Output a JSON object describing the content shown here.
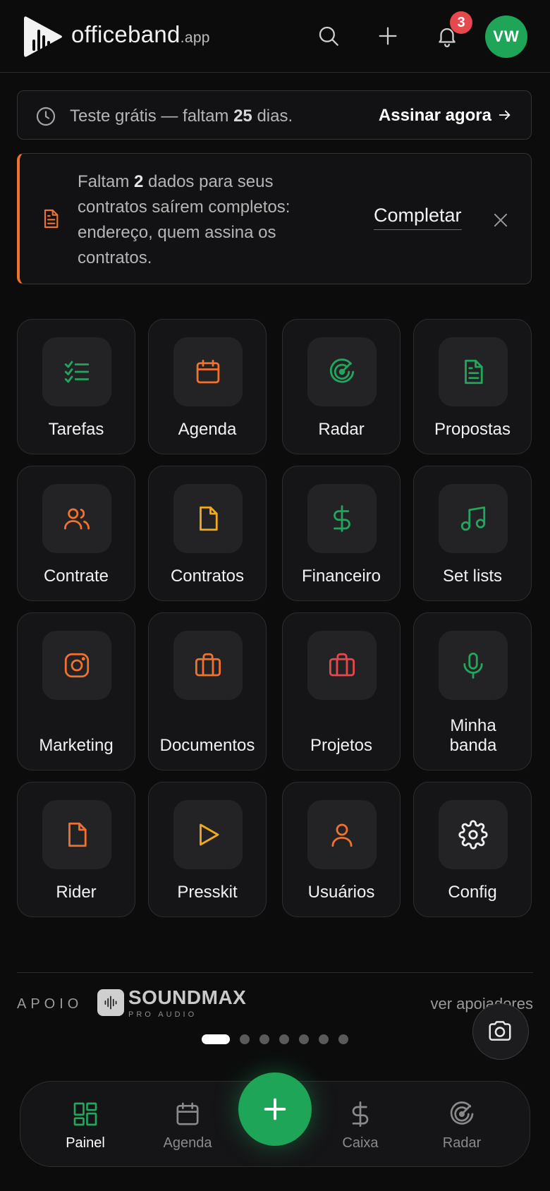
{
  "header": {
    "brand_name": "officeband",
    "brand_suffix": ".app",
    "notifications_count": "3",
    "avatar_initials": "VW"
  },
  "trial": {
    "text_before": "Teste grátis — faltam ",
    "days": "25",
    "text_after": " dias.",
    "cta": "Assinar agora"
  },
  "warning": {
    "text_before": "Faltam ",
    "count": "2",
    "text_after": " dados para seus contratos saírem completos: endereço, quem assina os contratos.",
    "action": "Completar"
  },
  "tiles": [
    {
      "label": "Tarefas",
      "icon": "checklist-icon",
      "color": "#22a55c"
    },
    {
      "label": "Agenda",
      "icon": "calendar-icon",
      "color": "#f07230"
    },
    {
      "label": "Radar",
      "icon": "radar-icon",
      "color": "#22a55c"
    },
    {
      "label": "Propostas",
      "icon": "file-text-icon",
      "color": "#22a55c"
    },
    {
      "label": "Contrate",
      "icon": "users-icon",
      "color": "#f07230"
    },
    {
      "label": "Contratos",
      "icon": "file-icon",
      "color": "#f2aa1a"
    },
    {
      "label": "Financeiro",
      "icon": "dollar-icon",
      "color": "#22a55c"
    },
    {
      "label": "Set lists",
      "icon": "music-icon",
      "color": "#22a55c"
    },
    {
      "label": "Marketing",
      "icon": "instagram-icon",
      "color": "#f07230"
    },
    {
      "label": "Documentos",
      "icon": "briefcase-icon",
      "color": "#f07230"
    },
    {
      "label": "Projetos",
      "icon": "briefcase-icon",
      "color": "#e5484d"
    },
    {
      "label": "Minha banda",
      "icon": "microphone-icon",
      "color": "#22a55c"
    },
    {
      "label": "Rider",
      "icon": "file-icon",
      "color": "#f07230"
    },
    {
      "label": "Presskit",
      "icon": "play-icon",
      "color": "#f2aa1a"
    },
    {
      "label": "Usuários",
      "icon": "user-icon",
      "color": "#f07230"
    },
    {
      "label": "Config",
      "icon": "gear-icon",
      "color": "#f0f0f0"
    }
  ],
  "sponsors": {
    "label": "APOIO",
    "sponsor_name": "SOUNDMAX",
    "sponsor_sub": "PRO AUDIO",
    "see_all": "ver apoiadores",
    "carousel_pages": 7,
    "carousel_active": 1
  },
  "nav": {
    "items": [
      {
        "label": "Painel",
        "icon": "dashboard-icon",
        "active": true
      },
      {
        "label": "Agenda",
        "icon": "calendar-icon",
        "active": false
      },
      {
        "label": "Caixa",
        "icon": "dollar-icon",
        "active": false
      },
      {
        "label": "Radar",
        "icon": "radar-icon",
        "active": false
      }
    ]
  },
  "colors": {
    "accent_green": "#1ea557",
    "accent_orange": "#f07230",
    "badge_red": "#e5484d"
  }
}
